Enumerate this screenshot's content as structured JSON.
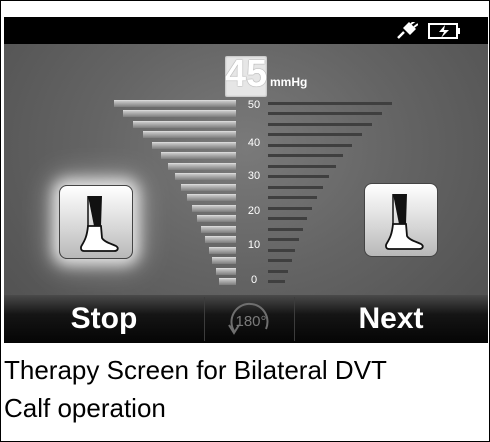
{
  "status_bar": {
    "icons": [
      "power-plug-icon",
      "battery-charging-icon"
    ]
  },
  "pressure": {
    "value": "45",
    "unit": "mmHg"
  },
  "scale": {
    "ticks": [
      "50",
      "40",
      "30",
      "20",
      "10",
      "0"
    ]
  },
  "limbs": {
    "left_icon": "leg-calf-icon",
    "left_active": true,
    "right_icon": "leg-calf-icon",
    "right_active": false
  },
  "bottom_bar": {
    "stop_label": "Stop",
    "rotate_label": "180°",
    "next_label": "Next"
  },
  "caption": {
    "line1": "Therapy Screen for Bilateral DVT",
    "line2": "Calf operation"
  },
  "colors": {
    "status_bar": "#000000",
    "background": "#646464",
    "text": "#ffffff"
  }
}
